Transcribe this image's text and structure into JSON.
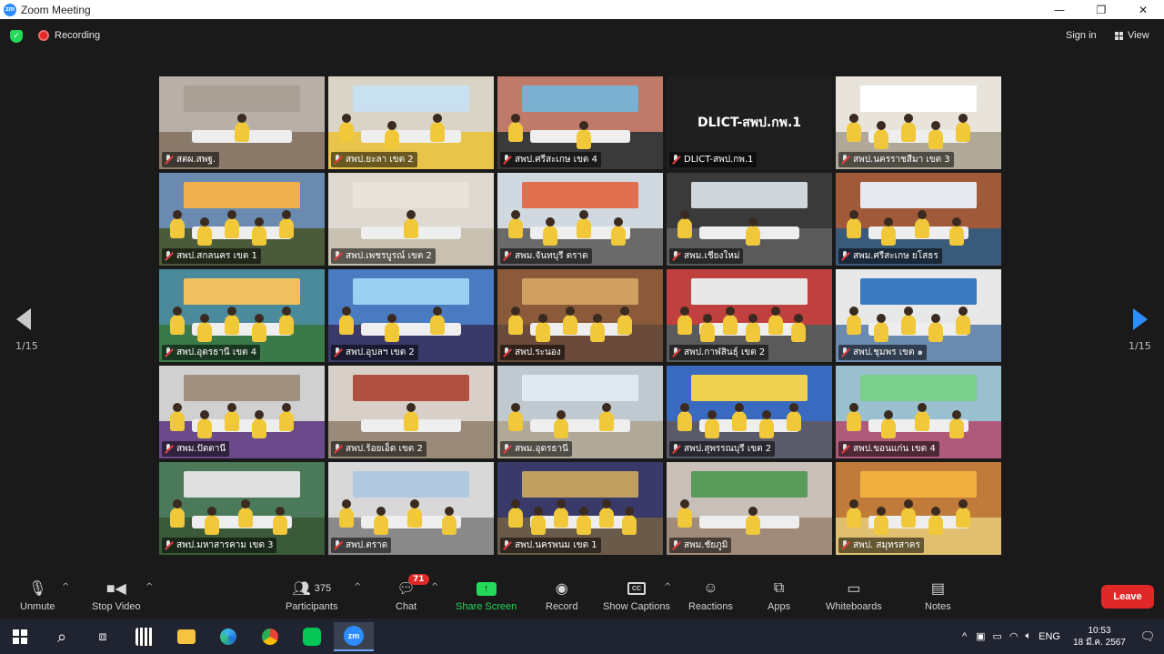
{
  "window": {
    "title": "Zoom Meeting",
    "app_icon_text": "zm",
    "controls": [
      "—",
      "❐",
      "✕"
    ]
  },
  "topbar": {
    "recording_label": "Recording",
    "signin_label": "Sign in",
    "view_label": "View"
  },
  "pagination": {
    "left": "1/15",
    "right": "1/15"
  },
  "tiles": [
    {
      "name": "สตผ.สพฐ.",
      "wall": "#b8b0a8",
      "floor": "#8a7a6a",
      "banner": "#a89f95",
      "people": 1,
      "active": true
    },
    {
      "name": "สพป.ยะลา เขต 2",
      "wall": "#d9d4c6",
      "floor": "#e8c54a",
      "banner": "#c9e0f0",
      "people": 3
    },
    {
      "name": "สพป.ศรีสะเกษ เขต 4",
      "wall": "#c07a6a",
      "floor": "#3a3a3a",
      "banner": "#7ab0d0",
      "people": 2
    },
    {
      "name": "DLICT-สพป.กพ.1",
      "text_only": true,
      "big_text": "DLICT-สพป.กพ.1"
    },
    {
      "name": "สพป.นครราชสีมา เขต 3",
      "wall": "#e8e4dc",
      "floor": "#b0a898",
      "banner": "#ffffff",
      "people": 5
    },
    {
      "name": "สพป.สกลนคร เขต 1",
      "wall": "#6a8ab0",
      "floor": "#4a5a3a",
      "banner": "#f0b050",
      "people": 5
    },
    {
      "name": "สพป.เพชรบูรณ์ เขต 2",
      "wall": "#dedad2",
      "floor": "#c8c0b0",
      "banner": "#e8e4dc",
      "people": 1
    },
    {
      "name": "สพม.จันทบุรี ตราด",
      "wall": "#d0d8e0",
      "floor": "#6a6a6a",
      "banner": "#e07050",
      "people": 4
    },
    {
      "name": "สพม.เชียงใหม่",
      "wall": "#3a3a3a",
      "floor": "#5a5a5a",
      "banner": "#cfd6dc",
      "people": 2
    },
    {
      "name": "สพม.ศรีสะเกษ ยโสธร",
      "wall": "#a05a3a",
      "floor": "#3a5a7a",
      "banner": "#e8e8f0",
      "people": 4
    },
    {
      "name": "สพป.อุดรธานี เขต 4",
      "wall": "#4a8a9a",
      "floor": "#3a7a4a",
      "banner": "#f0c060",
      "people": 5
    },
    {
      "name": "สพป.อุบลฯ เขต 2",
      "wall": "#4a7ac0",
      "floor": "#3a3a6a",
      "banner": "#9ad0f0",
      "people": 3
    },
    {
      "name": "สพป.ระนอง",
      "wall": "#8a5a3a",
      "floor": "#6a4a3a",
      "banner": "#d0a060",
      "people": 5
    },
    {
      "name": "สพป.กาฬสินธุ์ เขต 2",
      "wall": "#c04040",
      "floor": "#5a5a5a",
      "banner": "#e8e8e8",
      "people": 6
    },
    {
      "name": "สพป.ชุมพร เขต ๑",
      "wall": "#e8e8e8",
      "floor": "#6a8ab0",
      "banner": "#3a7ac0",
      "people": 5
    },
    {
      "name": "สพม.ปัตตานี",
      "wall": "#d0d0d0",
      "floor": "#6a4a8a",
      "banner": "#a09080",
      "people": 5
    },
    {
      "name": "สพป.ร้อยเอ็ด เขต 2",
      "wall": "#d8d0c8",
      "floor": "#9a8a7a",
      "banner": "#b05040",
      "people": 1
    },
    {
      "name": "สพม.อุดรธานี",
      "wall": "#c0c8d0",
      "floor": "#b0a898",
      "banner": "#e0e8f0",
      "people": 3
    },
    {
      "name": "สพป.สุพรรณบุรี เขต 2",
      "wall": "#3a6ac0",
      "floor": "#5a5a6a",
      "banner": "#f0d050",
      "people": 5
    },
    {
      "name": "สพป.ขอนแก่น เขต 4",
      "wall": "#9ac0d0",
      "floor": "#b05a7a",
      "banner": "#7ad08a",
      "people": 4
    },
    {
      "name": "สพป.มหาสารคาม เขต 3",
      "wall": "#4a7a5a",
      "floor": "#3a5a3a",
      "banner": "#e0e0e0",
      "people": 4
    },
    {
      "name": "สพป.ตราด",
      "wall": "#d8d8d8",
      "floor": "#8a8a8a",
      "banner": "#b0c8e0",
      "people": 4
    },
    {
      "name": "สพป.นครพนม เขต 1",
      "wall": "#3a3a6a",
      "floor": "#6a5a4a",
      "banner": "#c0a060",
      "people": 6
    },
    {
      "name": "สพม.ชัยภูมิ",
      "wall": "#c8c0b8",
      "floor": "#a08a7a",
      "banner": "#5a9a5a",
      "people": 2
    },
    {
      "name": "สพป. สมุทรสาคร",
      "wall": "#c07a3a",
      "floor": "#e0c070",
      "banner": "#f0b040",
      "people": 5
    }
  ],
  "toolbar": {
    "unmute": "Unmute",
    "stop_video": "Stop Video",
    "participants": "Participants",
    "participants_count": "375",
    "chat": "Chat",
    "chat_badge": "71",
    "share_screen": "Share Screen",
    "record": "Record",
    "show_captions": "Show Captions",
    "captions_icon_text": "CC",
    "reactions": "Reactions",
    "apps": "Apps",
    "whiteboards": "Whiteboards",
    "notes": "Notes",
    "leave": "Leave"
  },
  "taskbar": {
    "zoom_icon_text": "zm",
    "language": "ENG",
    "time": "10:53",
    "date": "18 มี.ค. 2567"
  },
  "colors": {
    "accent": "#2d8cff",
    "share_green": "#23d959",
    "leave_red": "#e02828",
    "active_speaker": "#e6d54a"
  }
}
